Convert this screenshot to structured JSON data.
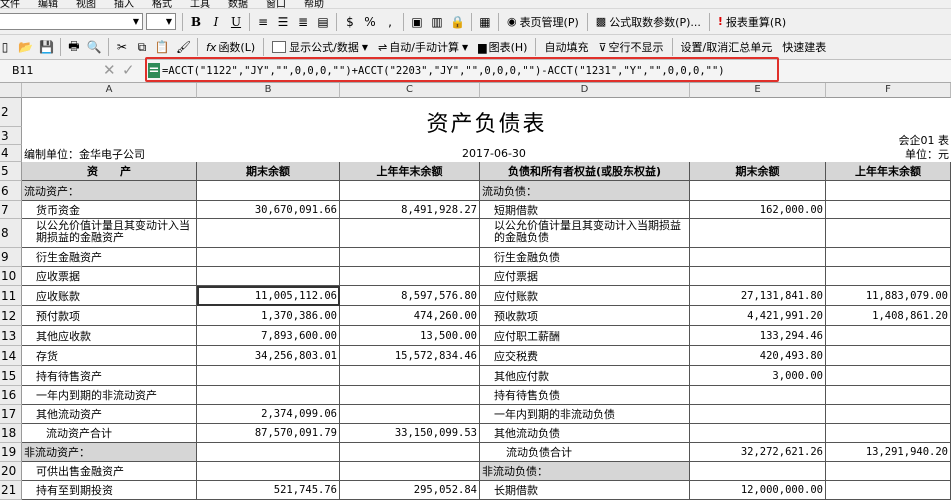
{
  "menubar": [
    "文件",
    "编辑",
    "视图",
    "插入",
    "格式",
    "工具",
    "数据",
    "窗口",
    "帮助"
  ],
  "toolbar1": {
    "bold": "B",
    "italic": "I",
    "underline": "U",
    "percent": "%",
    "page_manage": "表页管理(P)",
    "formula_params": "公式取数参数(P)...",
    "report_recalc": "报表重算(R)"
  },
  "toolbar2": {
    "function": "函数(L)",
    "show_formula": "显示公式/数据",
    "auto_manual": "自动/手动计算",
    "chart": "图表(H)",
    "auto_fill": "自动填充",
    "hide_empty": "空行不显示",
    "set_cancel_summary": "设置/取消汇总单元",
    "quick_build": "快速建表"
  },
  "formula_bar": {
    "cell_ref": "B11",
    "formula": "=ACCT(\"1122\",\"JY\",\"\",0,0,0,\"\")+ACCT(\"2203\",\"JY\",\"\",0,0,0,\"\")-ACCT(\"1231\",\"Y\",\"\",0,0,0,\"\")"
  },
  "columns": [
    "A",
    "B",
    "C",
    "D",
    "E",
    "F"
  ],
  "rows": [
    "2",
    "3",
    "4",
    "5",
    "6",
    "7",
    "8",
    "9",
    "10",
    "11",
    "12",
    "13",
    "14",
    "15",
    "16",
    "17",
    "18",
    "19",
    "20",
    "21"
  ],
  "sheet": {
    "title": "资产负债表",
    "form_no": "会企01 表",
    "unit_prefix": "编制单位：金华电子公司",
    "date": "2017-06-30",
    "currency": "单位：元",
    "headers": [
      "资　　产",
      "期末余额",
      "上年年末余额",
      "负债和所有者权益(或股东权益)",
      "期末余额",
      "上年年末余额"
    ],
    "body": [
      [
        "流动资产：",
        "",
        "",
        "流动负债：",
        "",
        ""
      ],
      [
        "货币资金",
        "30,670,091.66",
        "8,491,928.27",
        "短期借款",
        "162,000.00",
        ""
      ],
      [
        "以公允价值计量且其变动计入当期损益的金融资产",
        "",
        "",
        "以公允价值计量且其变动计入当期损益的金融负债",
        "",
        ""
      ],
      [
        "衍生金融资产",
        "",
        "",
        "衍生金融负债",
        "",
        ""
      ],
      [
        "应收票据",
        "",
        "",
        "应付票据",
        "",
        ""
      ],
      [
        "应收账款",
        "11,005,112.06",
        "8,597,576.80",
        "应付账款",
        "27,131,841.80",
        "11,883,079.00"
      ],
      [
        "预付款项",
        "1,370,386.00",
        "474,260.00",
        "预收款项",
        "4,421,991.20",
        "1,408,861.20"
      ],
      [
        "其他应收款",
        "7,893,600.00",
        "13,500.00",
        "应付职工薪酬",
        "133,294.46",
        ""
      ],
      [
        "存货",
        "34,256,803.01",
        "15,572,834.46",
        "应交税费",
        "420,493.80",
        ""
      ],
      [
        "持有待售资产",
        "",
        "",
        "其他应付款",
        "3,000.00",
        ""
      ],
      [
        "一年内到期的非流动资产",
        "",
        "",
        "持有待售负债",
        "",
        ""
      ],
      [
        "其他流动资产",
        "2,374,099.06",
        "",
        "一年内到期的非流动负债",
        "",
        ""
      ],
      [
        "流动资产合计",
        "87,570,091.79",
        "33,150,099.53",
        "其他流动负债",
        "",
        ""
      ],
      [
        "非流动资产：",
        "",
        "",
        "流动负债合计",
        "32,272,621.26",
        "13,291,940.20"
      ],
      [
        "可供出售金融资产",
        "",
        "",
        "非流动负债：",
        "",
        ""
      ],
      [
        "持有至到期投资",
        "521,745.76",
        "295,052.84",
        "长期借款",
        "12,000,000.00",
        ""
      ]
    ]
  }
}
